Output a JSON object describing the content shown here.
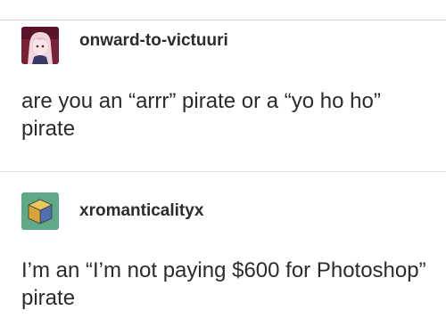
{
  "posts": [
    {
      "username": "onward-to-victuuri",
      "avatar_icon": "anime-character-avatar",
      "text": "are you an “arrr” pirate or a “yo ho ho” pirate"
    },
    {
      "username": "xromanticalityx",
      "avatar_icon": "cube-avatar",
      "text": "I’m an “I’m not paying $600 for Photoshop” pirate"
    }
  ],
  "colors": {
    "avatar1_bg": "#7a2038",
    "avatar2_bg": "#5fa888",
    "text": "#2b2b2b",
    "divider": "#e1e1e1"
  }
}
